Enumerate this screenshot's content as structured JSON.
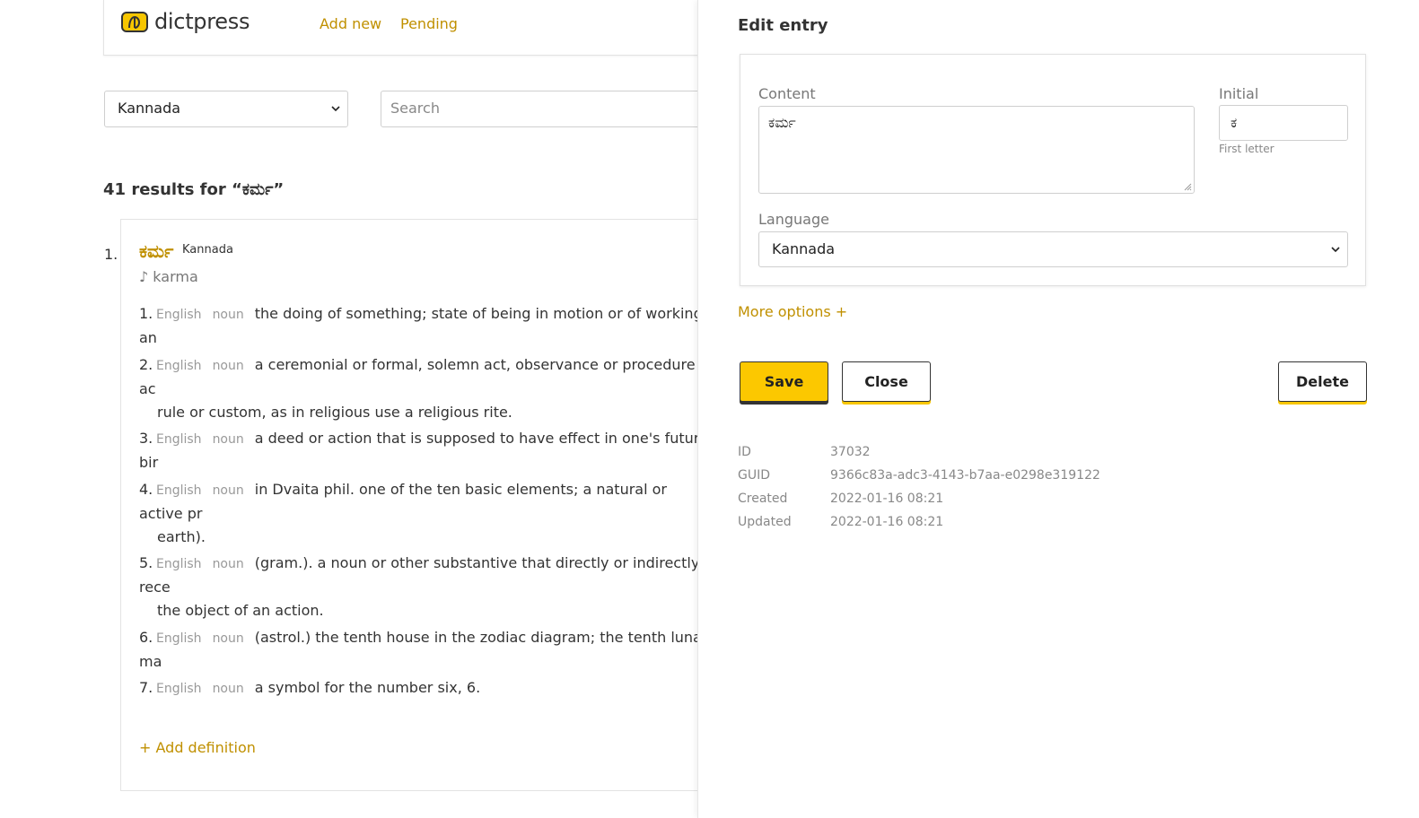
{
  "app": {
    "name": "dictpress"
  },
  "nav": {
    "add_new": "Add new",
    "pending": "Pending"
  },
  "search": {
    "language": "Kannada",
    "placeholder": "Search"
  },
  "results": {
    "title": "41 results for “ಕರ್ಮ”"
  },
  "entry": {
    "number": "1.",
    "headword": "ಕರ್ಮ",
    "language": "Kannada",
    "phonetic": "♪ karma",
    "definitions": [
      {
        "n": "1.",
        "lang": "English",
        "pos": "noun",
        "text": "the doing of something; state of being in motion or of working; an"
      },
      {
        "n": "2.",
        "lang": "English",
        "pos": "noun",
        "text": "a ceremonial or formal, solemn act, observance or procedure in ac",
        "text2": "rule or custom, as in religious use a religious rite."
      },
      {
        "n": "3.",
        "lang": "English",
        "pos": "noun",
        "text": "a deed or action that is supposed to have effect in one's future bir"
      },
      {
        "n": "4.",
        "lang": "English",
        "pos": "noun",
        "text": "in Dvaita phil. one of the ten basic elements; a natural or active pr",
        "text2": "earth)."
      },
      {
        "n": "5.",
        "lang": "English",
        "pos": "noun",
        "text": "(gram.). a noun or other substantive that directly or indirectly rece",
        "text2": "the object of an action."
      },
      {
        "n": "6.",
        "lang": "English",
        "pos": "noun",
        "text": "(astrol.) the tenth house in the zodiac diagram; the tenth lunar ma"
      },
      {
        "n": "7.",
        "lang": "English",
        "pos": "noun",
        "text": "a symbol for the number six, 6."
      }
    ],
    "add_definition": "+ Add definition"
  },
  "edit": {
    "title": "Edit entry",
    "content_label": "Content",
    "content_value": "ಕರ್ಮ",
    "initial_label": "Initial",
    "initial_value": "ಕ",
    "initial_help": "First letter",
    "language_label": "Language",
    "language_value": "Kannada",
    "more_options": "More options +",
    "save": "Save",
    "close": "Close",
    "delete": "Delete",
    "meta": {
      "id_label": "ID",
      "id": "37032",
      "guid_label": "GUID",
      "guid": "9366c83a-adc3-4143-b7aa-e0298e319122",
      "created_label": "Created",
      "created": "2022-01-16 08:21",
      "updated_label": "Updated",
      "updated": "2022-01-16 08:21"
    }
  },
  "colors": {
    "accent": "#c09000",
    "button_yellow": "#fcc800"
  }
}
